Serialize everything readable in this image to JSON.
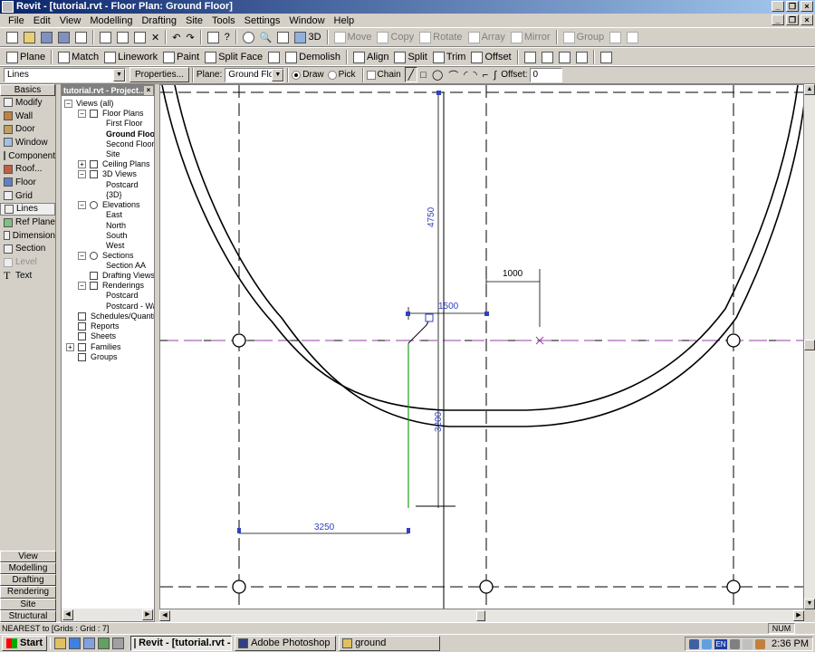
{
  "window": {
    "title": "Revit - [tutorial.rvt - Floor Plan: Ground Floor]"
  },
  "menu": [
    "File",
    "Edit",
    "View",
    "Modelling",
    "Drafting",
    "Site",
    "Tools",
    "Settings",
    "Window",
    "Help"
  ],
  "toolbar1": {
    "three_d": "3D",
    "move": "Move",
    "copy": "Copy",
    "rotate": "Rotate",
    "array": "Array",
    "mirror": "Mirror",
    "group": "Group"
  },
  "toolbar2": {
    "plane": "Plane",
    "match": "Match",
    "linework": "Linework",
    "paint": "Paint",
    "split_face": "Split Face",
    "demolish": "Demolish",
    "align": "Align",
    "split": "Split",
    "trim": "Trim",
    "offset": "Offset"
  },
  "options": {
    "type_value": "Lines",
    "properties": "Properties...",
    "plane_label": "Plane:",
    "plane_value": "Ground Floor",
    "draw": "Draw",
    "pick": "Pick",
    "chain": "Chain",
    "offset_label": "Offset:",
    "offset_value": "0"
  },
  "palette": {
    "header": "Basics",
    "items": [
      "Modify",
      "Wall",
      "Door",
      "Window",
      "Component",
      "Roof...",
      "Floor",
      "Grid",
      "Lines",
      "Ref Plane",
      "Dimension",
      "Section",
      "Level",
      "Text"
    ],
    "tabs": [
      "View",
      "Modelling",
      "Drafting",
      "Rendering",
      "Site",
      "Structural"
    ]
  },
  "browser": {
    "title": "tutorial.rvt - Project...",
    "nodes": [
      "Views (all)",
      "Floor Plans",
      "First Floor",
      "Ground Floor",
      "Second Floor",
      "Site",
      "Ceiling Plans",
      "3D Views",
      "Postcard",
      "{3D}",
      "Elevations",
      "East",
      "North",
      "South",
      "West",
      "Sections",
      "Section AA",
      "Drafting Views",
      "Renderings",
      "Postcard",
      "Postcard - Wall",
      "Schedules/Quantities",
      "Reports",
      "Sheets",
      "Families",
      "Groups"
    ]
  },
  "dimensions": {
    "d4750": "4750",
    "d1500": "1500",
    "d1000": "1000",
    "d3200": "3200",
    "d3250": "3250"
  },
  "status": {
    "text": "NEAREST  to [Grids : Grid : 7]",
    "num": "NUM"
  },
  "taskbar": {
    "start": "Start",
    "tasks": [
      "Revit - [tutorial.rvt -...",
      "Adobe Photoshop",
      "ground"
    ],
    "lang": "EN",
    "clock": "2:36 PM"
  }
}
